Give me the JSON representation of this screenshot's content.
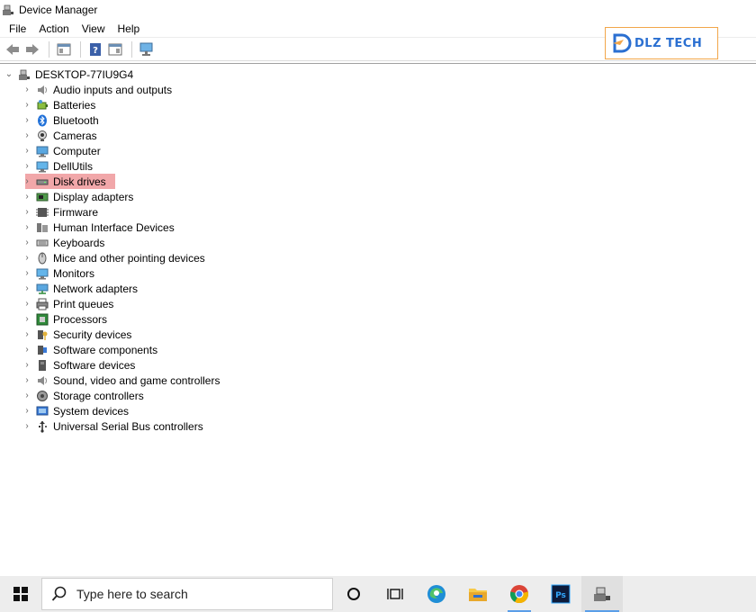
{
  "window": {
    "title": "Device Manager"
  },
  "menu": [
    "File",
    "Action",
    "View",
    "Help"
  ],
  "logo": {
    "text": "DLZ TECH"
  },
  "tree": {
    "root": "DESKTOP-77IU9G4",
    "items": [
      {
        "label": "Audio inputs and outputs",
        "icon": "speaker-icon"
      },
      {
        "label": "Batteries",
        "icon": "battery-icon"
      },
      {
        "label": "Bluetooth",
        "icon": "bluetooth-icon"
      },
      {
        "label": "Cameras",
        "icon": "camera-icon"
      },
      {
        "label": "Computer",
        "icon": "computer-icon"
      },
      {
        "label": "DellUtils",
        "icon": "monitor-icon"
      },
      {
        "label": "Disk drives",
        "icon": "disk-drive-icon"
      },
      {
        "label": "Display adapters",
        "icon": "display-adapter-icon"
      },
      {
        "label": "Firmware",
        "icon": "firmware-icon"
      },
      {
        "label": "Human Interface Devices",
        "icon": "hid-icon"
      },
      {
        "label": "Keyboards",
        "icon": "keyboard-icon"
      },
      {
        "label": "Mice and other pointing devices",
        "icon": "mouse-icon"
      },
      {
        "label": "Monitors",
        "icon": "monitor-icon"
      },
      {
        "label": "Network adapters",
        "icon": "network-icon"
      },
      {
        "label": "Print queues",
        "icon": "printer-icon"
      },
      {
        "label": "Processors",
        "icon": "processor-icon"
      },
      {
        "label": "Security devices",
        "icon": "security-icon"
      },
      {
        "label": "Software components",
        "icon": "software-component-icon"
      },
      {
        "label": "Software devices",
        "icon": "software-device-icon"
      },
      {
        "label": "Sound, video and game controllers",
        "icon": "sound-icon"
      },
      {
        "label": "Storage controllers",
        "icon": "storage-icon"
      },
      {
        "label": "System devices",
        "icon": "system-icon"
      },
      {
        "label": "Universal Serial Bus controllers",
        "icon": "usb-icon"
      }
    ],
    "highlighted_index": 6
  },
  "taskbar": {
    "search_placeholder": "Type here to search"
  }
}
